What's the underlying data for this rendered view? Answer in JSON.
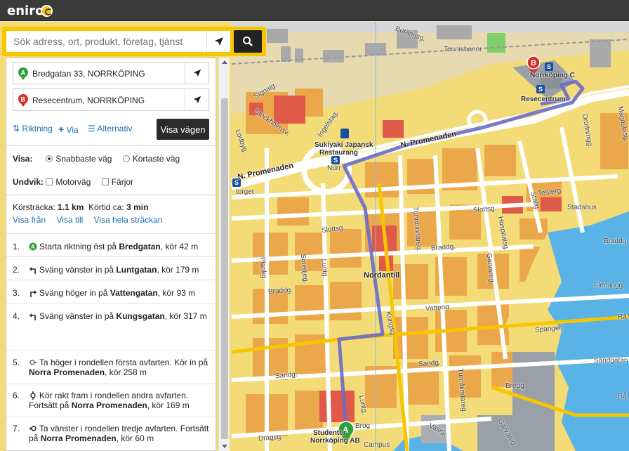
{
  "app": {
    "logo_text": "eniro"
  },
  "search": {
    "placeholder": "Sök adress, ort, produkt, företag, tjänst"
  },
  "route": {
    "from": "Bredgatan 33, NORRKÖPING",
    "to": "Resecentrum, NORRKÖPING",
    "tools": {
      "direction": "Riktning",
      "via": "Via",
      "alternatives": "Alternativ"
    },
    "show_button": "Visa vägen",
    "visa_label": "Visa:",
    "fastest": "Snabbaste väg",
    "shortest": "Kortaste väg",
    "avoid_label": "Undvik:",
    "motorway": "Motorväg",
    "ferries": "Färjor",
    "distance_label": "Körsträcka:",
    "distance": "1.1 km",
    "time_label": "Körtid ca:",
    "time": "3 min",
    "links": {
      "from": "Visa från",
      "to": "Visa till",
      "whole": "Visa hela sträckan"
    }
  },
  "steps": [
    {
      "num": "1.",
      "pre": "Starta riktning öst på ",
      "street": "Bredgatan",
      "post": ", kör 42 m",
      "icon": "start-a-icon"
    },
    {
      "num": "2.",
      "pre": "Sväng vänster in på ",
      "street": "Luntgatan",
      "post": ", kör 179 m",
      "icon": "turn-left-icon"
    },
    {
      "num": "3.",
      "pre": "Sväng höger in på ",
      "street": "Vattengatan",
      "post": ", kör 93 m",
      "icon": "turn-right-icon"
    },
    {
      "num": "4.",
      "pre": "Sväng vänster in på ",
      "street": "Kungsgatan",
      "post": ", kör 317 m",
      "icon": "turn-left-icon"
    },
    {
      "num": "5.",
      "pre": "Ta höger i rondellen första avfarten. Kör in på ",
      "street": "Norra Promenaden",
      "post": ", kör 258 m",
      "icon": "roundabout-right-icon"
    },
    {
      "num": "6.",
      "pre": "Kör rakt fram i rondellen andra avfarten. Fortsätt på ",
      "street": "Norra Promenaden",
      "post": ", kör 169 m",
      "icon": "roundabout-straight-icon"
    },
    {
      "num": "7.",
      "pre": "Ta vänster i rondellen tredje avfarten. Fortsätt på ",
      "street": "Norra Promenaden",
      "post": ", kör 60 m",
      "icon": "roundabout-left-icon"
    }
  ],
  "map_labels": {
    "butangsg": "Butängsg.",
    "tennisbanor": "Tennisbanor",
    "norrkoping_c": "Norrköping C",
    "resecentrum": "Resecentrum",
    "n_promenaden": "N. Promenaden",
    "n_promenaden2": "N. Promenaden",
    "sukiyaki": "Sukiyaki Japansk",
    "restaurang": "Restaurang",
    "norr": "Norr",
    "torget": "torget",
    "slottsg": "Slottsg.",
    "slottsg2": "Slottsg.",
    "nordantill": "Nordantill",
    "braddg": "Braddg.",
    "braddg2": "Braddg.",
    "braddg3": "Braddg.",
    "vatteng": "Vatteng.",
    "sandg": "Sandg.",
    "sandg2": "Sandg.",
    "bredg": "Bredg.",
    "spangen": "Spangen",
    "stadshus": "Stadshus",
    "teaterg": "Teaterg.",
    "drottningg": "Drottningg.",
    "lodbyg": "Lödbyg.",
    "sockholmsv": "Stockholmsv.",
    "ingelstag": "Ingelstag.",
    "signalg": "Signalg.",
    "studenter": "Studenter",
    "norrkoping_ab": "Norrköping AB",
    "campus": "Campus",
    "dragsg": "Dragsg.",
    "flemingg": "Flemingg.",
    "sandgatan": "Sandgatan",
    "kungsg": "Kungsg.",
    "tunnbindareg": "Tunnbindareg.",
    "tunnbindareg2": "Tunnbindareg.",
    "garvareg": "Garvareg.",
    "garvareg2": "Garvareg.",
    "hospitalsg": "Hospitalsg.",
    "lunng": "Luntg.",
    "smedjeg": "Smedjeg.",
    "plankg": "Plankg.",
    "stallg": "Stallg.",
    "magasinsg": "Magasinsg.",
    "rad": "Rå",
    "rad2": "Rå",
    "vasig": "Vasig.",
    "luntg": "Luntg.",
    "lodbyg2": "Lödbyg.",
    "brog": "Brog"
  },
  "colors": {
    "accent": "#f7c600",
    "route": "#6a6ac8",
    "link": "#1a6fb5"
  }
}
